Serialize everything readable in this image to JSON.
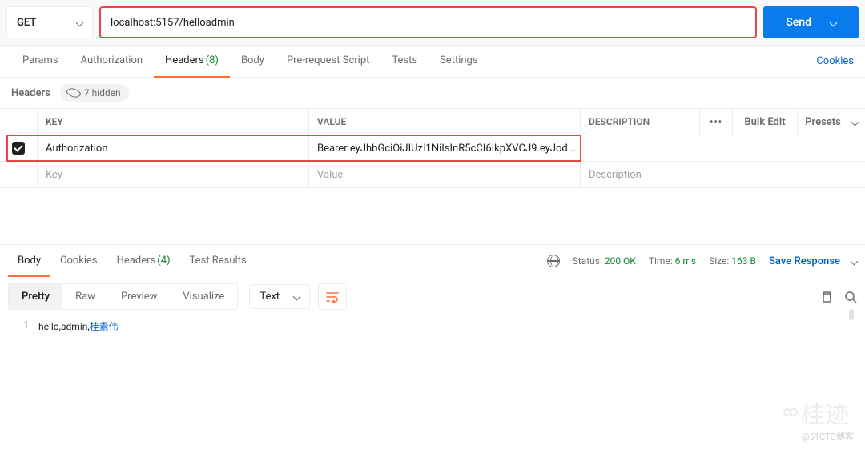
{
  "request": {
    "method": "GET",
    "url": "localhost:5157/helloadmin",
    "send_label": "Send"
  },
  "tabs": {
    "params": "Params",
    "auth": "Authorization",
    "headers": "Headers",
    "headers_count": "(8)",
    "body": "Body",
    "prerequest": "Pre-request Script",
    "tests": "Tests",
    "settings": "Settings",
    "cookies": "Cookies"
  },
  "headers_section": {
    "title": "Headers",
    "hidden_label": "7 hidden",
    "cols": {
      "key": "KEY",
      "value": "VALUE",
      "desc": "DESCRIPTION"
    },
    "bulk": "Bulk Edit",
    "presets": "Presets",
    "rows": [
      {
        "key": "Authorization",
        "value": "Bearer eyJhbGciOiJIUzI1NiIsInR5cCI6IkpXVCJ9.eyJod..."
      }
    ],
    "placeholder": {
      "key": "Key",
      "value": "Value",
      "desc": "Description"
    }
  },
  "response": {
    "tabs": {
      "body": "Body",
      "cookies": "Cookies",
      "headers": "Headers",
      "headers_count": "(4)",
      "tests": "Test Results"
    },
    "status_label": "Status:",
    "status_value": "200 OK",
    "time_label": "Time:",
    "time_value": "6 ms",
    "size_label": "Size:",
    "size_value": "163 B",
    "save_label": "Save Response",
    "views": {
      "pretty": "Pretty",
      "raw": "Raw",
      "preview": "Preview",
      "visualize": "Visualize"
    },
    "format": "Text",
    "body_lines": [
      {
        "n": "1",
        "text": "hello,admin,",
        "cjk": "桂素伟"
      }
    ]
  },
  "watermark": {
    "main": "桂迹",
    "sub": "@51CTO博客"
  }
}
